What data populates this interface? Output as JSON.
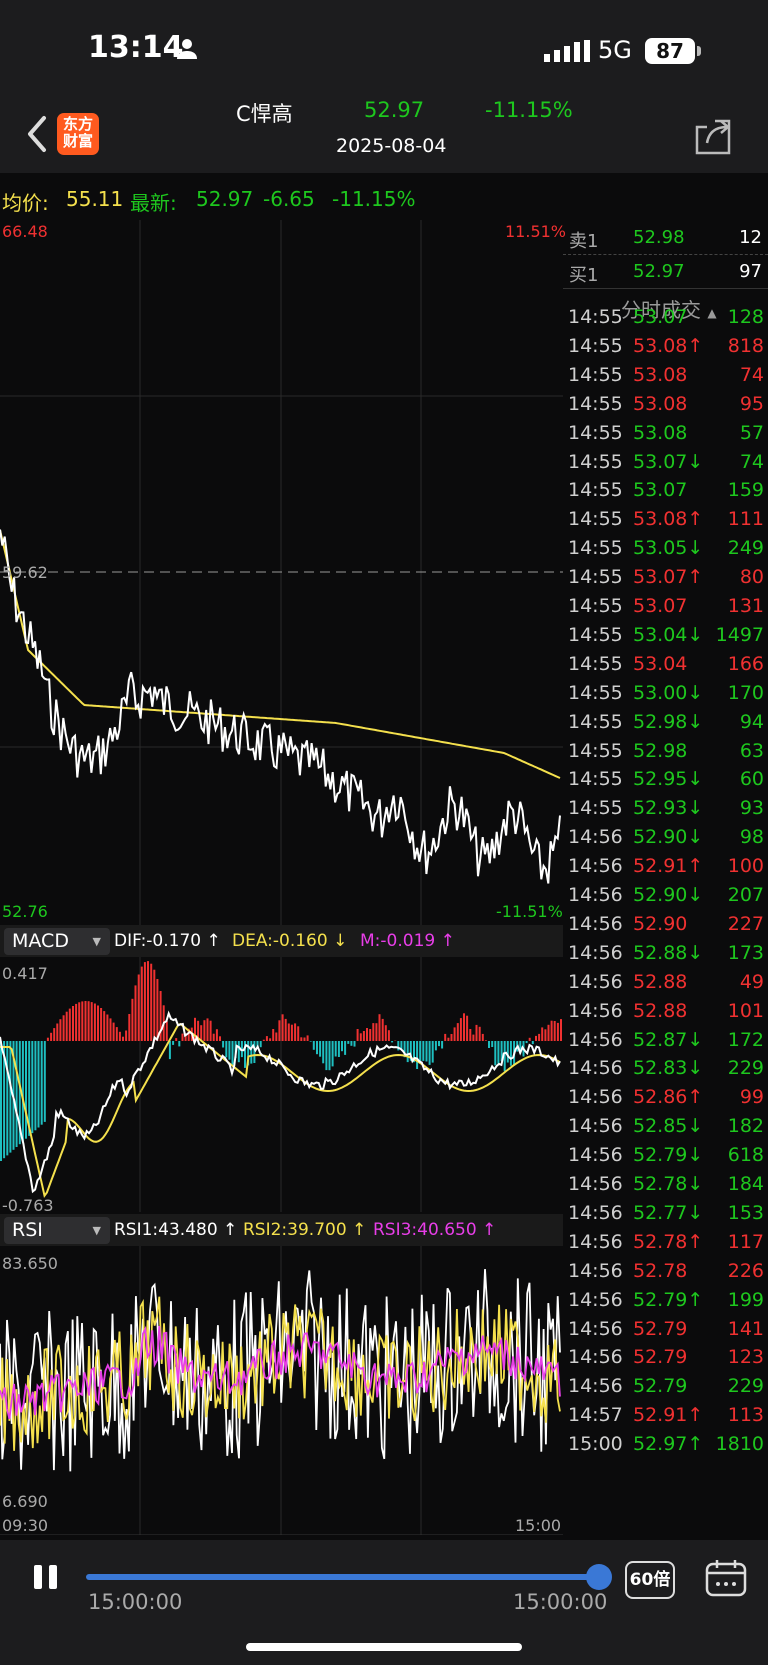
{
  "status_bar": {
    "time": "13:14",
    "network": "5G",
    "battery": "87"
  },
  "header": {
    "logo_line1": "东方",
    "logo_line2": "财富",
    "name": "C悍高",
    "price": "52.97",
    "change_pct": "-11.15%",
    "date": "2025-08-04"
  },
  "quote": {
    "avg_label": "均价:",
    "avg_value": "55.11",
    "latest_label": "最新:",
    "latest_value": "52.97",
    "change": "-6.65",
    "change_pct": "-11.15%"
  },
  "price_chart": {
    "high": "66.48",
    "high_pct": "11.51%",
    "ref": "59.62",
    "low": "52.76",
    "low_pct": "-11.51%"
  },
  "macd": {
    "label": "MACD",
    "dif": "DIF:-0.170 ↑",
    "dea": "DEA:-0.160 ↓",
    "m": "M:-0.019 ↑",
    "max": "0.417",
    "min": "-0.763"
  },
  "rsi": {
    "label": "RSI",
    "rsi1": "RSI1:43.480 ↑",
    "rsi2": "RSI2:39.700 ↑",
    "rsi3": "RSI3:40.650 ↑",
    "max": "83.650",
    "min": "6.690"
  },
  "time_axis": {
    "start": "09:30",
    "end": "15:00"
  },
  "order_book": [
    {
      "label": "卖1",
      "price": "52.98",
      "volume": "12"
    },
    {
      "label": "买1",
      "price": "52.97",
      "volume": "97"
    }
  ],
  "trades_title": "分时成交",
  "trades": [
    {
      "time": "14:55",
      "price": "53.07",
      "vol": "128",
      "c": "green"
    },
    {
      "time": "14:55",
      "price": "53.08↑",
      "vol": "818",
      "c": "red"
    },
    {
      "time": "14:55",
      "price": "53.08",
      "vol": "74",
      "c": "red"
    },
    {
      "time": "14:55",
      "price": "53.08",
      "vol": "95",
      "c": "red"
    },
    {
      "time": "14:55",
      "price": "53.08",
      "vol": "57",
      "c": "green"
    },
    {
      "time": "14:55",
      "price": "53.07↓",
      "vol": "74",
      "c": "green"
    },
    {
      "time": "14:55",
      "price": "53.07",
      "vol": "159",
      "c": "green"
    },
    {
      "time": "14:55",
      "price": "53.08↑",
      "vol": "111",
      "c": "red"
    },
    {
      "time": "14:55",
      "price": "53.05↓",
      "vol": "249",
      "c": "green"
    },
    {
      "time": "14:55",
      "price": "53.07↑",
      "vol": "80",
      "c": "red"
    },
    {
      "time": "14:55",
      "price": "53.07",
      "vol": "131",
      "c": "red"
    },
    {
      "time": "14:55",
      "price": "53.04↓",
      "vol": "1497",
      "c": "green"
    },
    {
      "time": "14:55",
      "price": "53.04",
      "vol": "166",
      "c": "red"
    },
    {
      "time": "14:55",
      "price": "53.00↓",
      "vol": "170",
      "c": "green"
    },
    {
      "time": "14:55",
      "price": "52.98↓",
      "vol": "94",
      "c": "green"
    },
    {
      "time": "14:55",
      "price": "52.98",
      "vol": "63",
      "c": "green"
    },
    {
      "time": "14:55",
      "price": "52.95↓",
      "vol": "60",
      "c": "green"
    },
    {
      "time": "14:55",
      "price": "52.93↓",
      "vol": "93",
      "c": "green"
    },
    {
      "time": "14:56",
      "price": "52.90↓",
      "vol": "98",
      "c": "green"
    },
    {
      "time": "14:56",
      "price": "52.91↑",
      "vol": "100",
      "c": "red"
    },
    {
      "time": "14:56",
      "price": "52.90↓",
      "vol": "207",
      "c": "green"
    },
    {
      "time": "14:56",
      "price": "52.90",
      "vol": "227",
      "c": "red"
    },
    {
      "time": "14:56",
      "price": "52.88↓",
      "vol": "173",
      "c": "green"
    },
    {
      "time": "14:56",
      "price": "52.88",
      "vol": "49",
      "c": "red"
    },
    {
      "time": "14:56",
      "price": "52.88",
      "vol": "101",
      "c": "red"
    },
    {
      "time": "14:56",
      "price": "52.87↓",
      "vol": "172",
      "c": "green"
    },
    {
      "time": "14:56",
      "price": "52.83↓",
      "vol": "229",
      "c": "green"
    },
    {
      "time": "14:56",
      "price": "52.86↑",
      "vol": "99",
      "c": "red"
    },
    {
      "time": "14:56",
      "price": "52.85↓",
      "vol": "182",
      "c": "green"
    },
    {
      "time": "14:56",
      "price": "52.79↓",
      "vol": "618",
      "c": "green"
    },
    {
      "time": "14:56",
      "price": "52.78↓",
      "vol": "184",
      "c": "green"
    },
    {
      "time": "14:56",
      "price": "52.77↓",
      "vol": "153",
      "c": "green"
    },
    {
      "time": "14:56",
      "price": "52.78↑",
      "vol": "117",
      "c": "red"
    },
    {
      "time": "14:56",
      "price": "52.78",
      "vol": "226",
      "c": "red"
    },
    {
      "time": "14:56",
      "price": "52.79↑",
      "vol": "199",
      "c": "green"
    },
    {
      "time": "14:56",
      "price": "52.79",
      "vol": "141",
      "c": "red"
    },
    {
      "time": "14:56",
      "price": "52.79",
      "vol": "123",
      "c": "red"
    },
    {
      "time": "14:56",
      "price": "52.79",
      "vol": "229",
      "c": "green"
    },
    {
      "time": "14:57",
      "price": "52.91↑",
      "vol": "113",
      "c": "red"
    },
    {
      "time": "15:00",
      "price": "52.97↑",
      "vol": "1810",
      "c": "green"
    }
  ],
  "player": {
    "start_time": "15:00:00",
    "end_time": "15:00:00",
    "speed": "60倍",
    "progress": 1.0
  },
  "colors": {
    "up": "#f03131",
    "down": "#1ec71e",
    "avg_line": "#f4e04d",
    "price_line": "#ffffff",
    "rsi3": "#e83ee8",
    "accent": "#3a78d6"
  },
  "icons": [
    "back-chevron-icon",
    "share-icon",
    "pause-icon",
    "calendar-icon",
    "person-icon",
    "signal-icon",
    "battery-icon"
  ]
}
